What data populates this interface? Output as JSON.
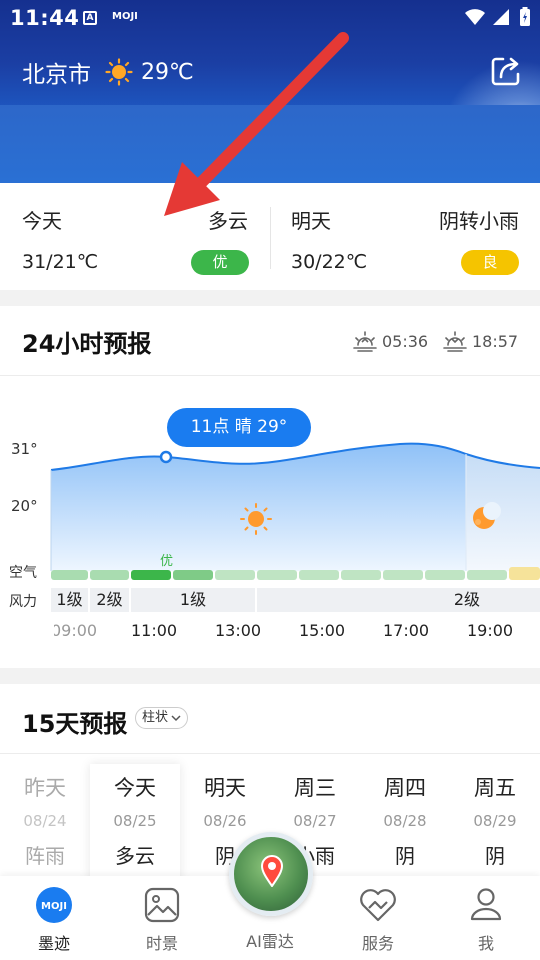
{
  "status_bar": {
    "time": "11:44",
    "notif_a": "A",
    "notif_app": "MOJI"
  },
  "header": {
    "city": "北京市",
    "current_temp": "29℃"
  },
  "today": {
    "label": "今天",
    "condition": "多云",
    "range": "31/21℃",
    "aqi": "优"
  },
  "tomorrow": {
    "label": "明天",
    "condition": "阴转小雨",
    "range": "30/22℃",
    "aqi": "良"
  },
  "hourly": {
    "title": "24小时预报",
    "sunrise": "05:36",
    "sunset": "18:57",
    "y_labels": [
      "31°",
      "20°"
    ],
    "row_labels": {
      "air": "空气",
      "wind": "风力"
    },
    "tooltip": "11点 晴 29°",
    "aqi_label": "优",
    "wind_segments": [
      "1级",
      "2级",
      "1级",
      "2级"
    ],
    "hours": [
      "09:00",
      "11:00",
      "13:00",
      "15:00",
      "17:00",
      "19:00"
    ]
  },
  "daily": {
    "title": "15天预报",
    "mode_chip": "柱状",
    "days": [
      {
        "weekday": "昨天",
        "date": "08/24",
        "condition": "阵雨",
        "state": "past"
      },
      {
        "weekday": "今天",
        "date": "08/25",
        "condition": "多云",
        "state": "selected"
      },
      {
        "weekday": "明天",
        "date": "08/26",
        "condition": "阴",
        "state": "normal"
      },
      {
        "weekday": "周三",
        "date": "08/27",
        "condition": "小雨",
        "state": "normal"
      },
      {
        "weekday": "周四",
        "date": "08/28",
        "condition": "阴",
        "state": "normal"
      },
      {
        "weekday": "周五",
        "date": "08/29",
        "condition": "阴",
        "state": "normal"
      }
    ]
  },
  "nav": {
    "items": [
      {
        "label": "墨迹",
        "icon": "moji-logo-icon",
        "active": true
      },
      {
        "label": "时景",
        "icon": "photo-icon",
        "active": false
      },
      {
        "label": "AI雷达",
        "icon": "radar-icon",
        "active": false
      },
      {
        "label": "服务",
        "icon": "service-heart-icon",
        "active": false
      },
      {
        "label": "我",
        "icon": "profile-icon",
        "active": false
      }
    ],
    "logo_text": "MOJI"
  },
  "colors": {
    "header_top": "#15308f",
    "header_bottom": "#1e63cc",
    "aqi_good": "#3cb64a",
    "aqi_ok": "#f5c400",
    "accent_blue": "#1a7cf0",
    "annotation_arrow": "#e53935"
  }
}
